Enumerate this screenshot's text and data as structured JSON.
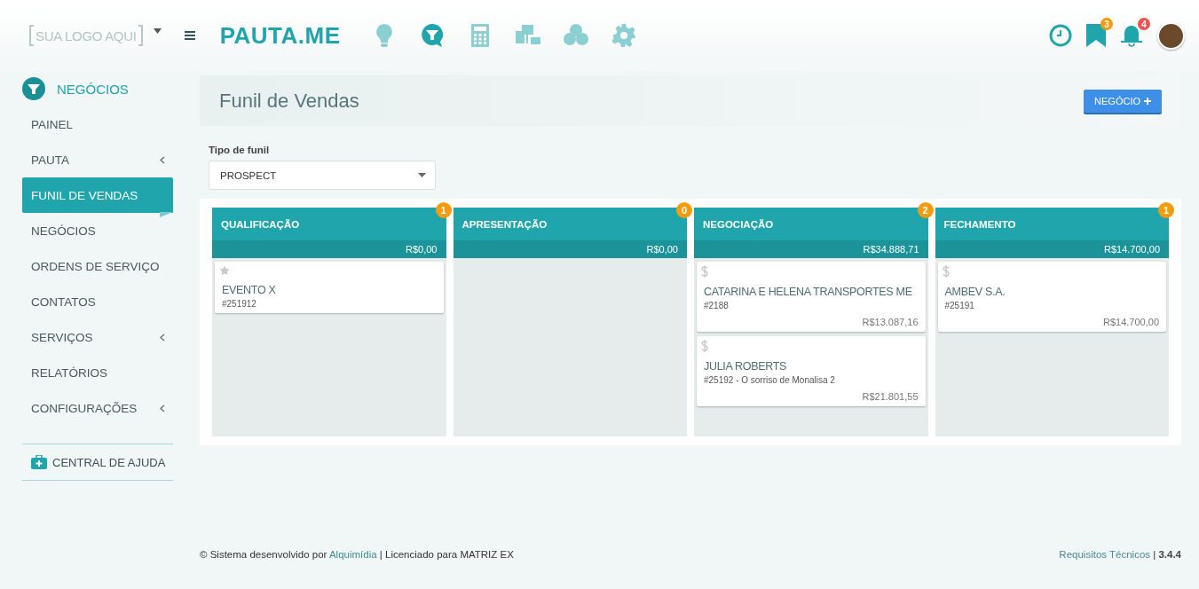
{
  "header": {
    "logo_placeholder": "SUA LOGO AQUI",
    "brand": "PAUTA.ME",
    "apps": [
      {
        "kind": "bulb",
        "selected": false
      },
      {
        "kind": "funnel",
        "selected": true
      },
      {
        "kind": "calculator",
        "selected": false
      },
      {
        "kind": "board",
        "selected": false
      },
      {
        "kind": "coins",
        "selected": false
      },
      {
        "kind": "gear",
        "selected": false
      }
    ],
    "notifications": [
      {
        "kind": "clock"
      },
      {
        "kind": "bookmark",
        "badge": "3",
        "color": "#f39c12"
      },
      {
        "kind": "bell",
        "badge": "4",
        "color": "#ef5350"
      }
    ]
  },
  "sidebar": {
    "section": "NEGÓCIOS",
    "items": [
      {
        "label": "PAINEL",
        "selected": false,
        "submenu": false
      },
      {
        "label": "PAUTA",
        "selected": false,
        "submenu": true
      },
      {
        "label": "FUNIL DE VENDAS",
        "selected": true,
        "submenu": false
      },
      {
        "label": "NEGÓCIOS",
        "selected": false,
        "submenu": false
      },
      {
        "label": "ORDENS DE SERVIÇO",
        "selected": false,
        "submenu": false
      },
      {
        "label": "CONTATOS",
        "selected": false,
        "submenu": false
      },
      {
        "label": "SERVIÇOS",
        "selected": false,
        "submenu": true
      },
      {
        "label": "RELATÓRIOS",
        "selected": false,
        "submenu": false
      },
      {
        "label": "CONFIGURAÇÕES",
        "selected": false,
        "submenu": true
      }
    ],
    "help": "CENTRAL DE AJUDA"
  },
  "page": {
    "title": "Funil de Vendas",
    "new_button": "NEGÓCIO",
    "filter_label": "Tipo de funil",
    "filter_value": "PROSPECT"
  },
  "columns": [
    {
      "title": "QUALIFICAÇÃO",
      "count": "1",
      "total": "R$0,00",
      "cards": [
        {
          "kind": "star",
          "title": "EVENTO X",
          "ref": "#251912"
        }
      ]
    },
    {
      "title": "APRESENTAÇÃO",
      "count": "0",
      "total": "R$0,00"
    },
    {
      "title": "NEGOCIAÇÃO",
      "count": "2",
      "total": "R$34.888,71",
      "cards": [
        {
          "kind": "dollar",
          "title": "CATARINA E HELENA TRANSPORTES ME",
          "ref": "#2188",
          "value": "R$13.087,16"
        },
        {
          "kind": "dollar",
          "title": "JULIA ROBERTS",
          "ref": "#25192 - O sorriso de Monalisa 2",
          "value": "R$21.801,55"
        }
      ]
    },
    {
      "title": "FECHAMENTO",
      "count": "1",
      "total": "R$14.700,00",
      "cards": [
        {
          "kind": "dollar",
          "title": "AMBEV S.A.",
          "ref": "#25191",
          "value": "R$14.700,00"
        }
      ]
    }
  ],
  "footer": {
    "prefix": "© Sistema desenvolvido por",
    "link": "Alquimídia",
    "suffix": "| Licenciado para MATRIZ EX",
    "requirements": "Requisitos Técnicos",
    "separator": "|",
    "version": "3.4.4"
  }
}
